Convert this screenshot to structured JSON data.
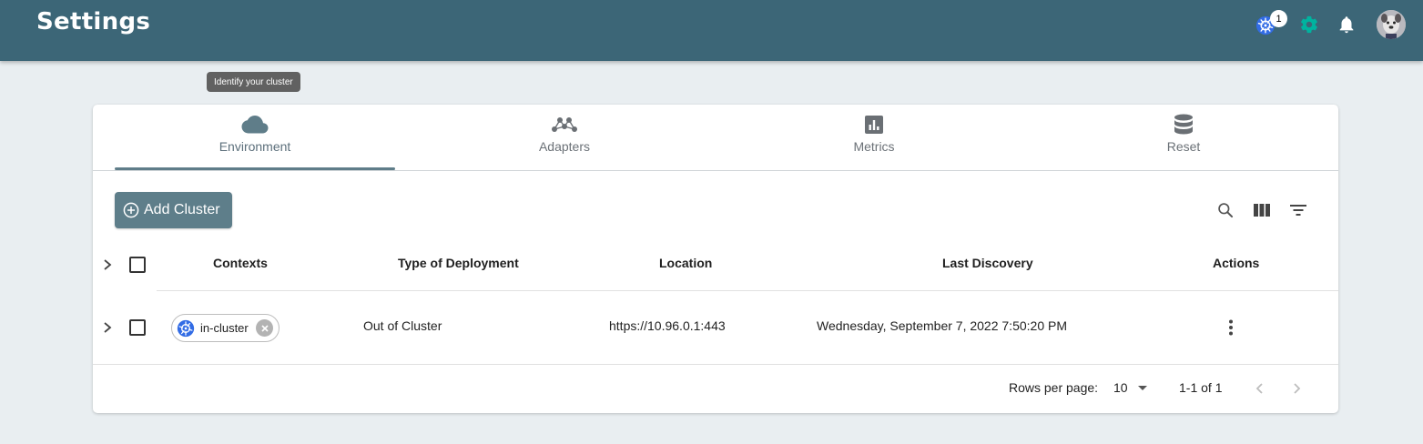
{
  "header": {
    "title": "Settings",
    "kubernetes_badge_count": "1",
    "icons": [
      "kubernetes-icon",
      "gear-icon",
      "bell-icon",
      "avatar"
    ]
  },
  "tooltip": {
    "text": "Identify your cluster"
  },
  "tabs": [
    {
      "label": "Environment",
      "icon": "cloud-icon",
      "active": true
    },
    {
      "label": "Adapters",
      "icon": "adapters-icon",
      "active": false
    },
    {
      "label": "Metrics",
      "icon": "metrics-icon",
      "active": false
    },
    {
      "label": "Reset",
      "icon": "database-icon",
      "active": false
    }
  ],
  "toolbar": {
    "add_cluster_label": "Add Cluster",
    "icons": [
      "search-icon",
      "columns-icon",
      "filter-icon"
    ]
  },
  "table": {
    "columns": [
      "Contexts",
      "Type of Deployment",
      "Location",
      "Last Discovery",
      "Actions"
    ],
    "rows": [
      {
        "context": "in-cluster",
        "type_of_deployment": "Out of Cluster",
        "location": "https://10.96.0.1:443",
        "last_discovery": "Wednesday, September 7, 2022 7:50:20 PM"
      }
    ]
  },
  "pagination": {
    "rows_per_page_label": "Rows per page:",
    "rows_per_page_value": "10",
    "range": "1-1 of 1"
  },
  "colors": {
    "header_bg": "#3c6677",
    "accent": "#5e7e8a",
    "gear": "#00b39f",
    "kubernetes": "#326ce5",
    "page_bg": "#e9eef1"
  }
}
